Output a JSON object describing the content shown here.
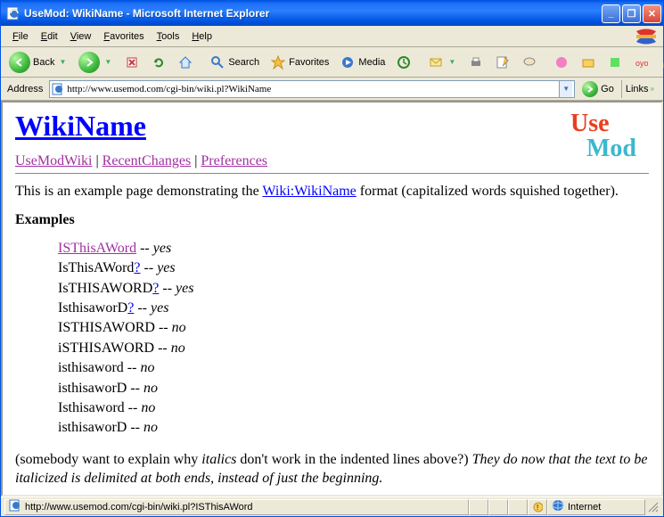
{
  "titlebar": {
    "title": "UseMod: WikiName - Microsoft Internet Explorer"
  },
  "menubar": {
    "items": [
      "File",
      "Edit",
      "View",
      "Favorites",
      "Tools",
      "Help"
    ]
  },
  "toolbar": {
    "back": "Back",
    "search": "Search",
    "favorites": "Favorites",
    "media": "Media"
  },
  "addressbar": {
    "label": "Address",
    "url": "http://www.usemod.com/cgi-bin/wiki.pl?WikiName",
    "go": "Go",
    "links": "Links"
  },
  "page": {
    "title": "WikiName",
    "nav": {
      "usemodwiki": "UseModWiki",
      "recentchanges": "RecentChanges",
      "preferences": "Preferences"
    },
    "intro_before": "This is an example page demonstrating the ",
    "intro_link": "Wiki:WikiName",
    "intro_after": " format (capitalized words squished together).",
    "examples_heading": "Examples",
    "examples": [
      {
        "text": "ISThisAWord",
        "link_class": "",
        "qmark": false,
        "dash": " -- ",
        "result": "yes"
      },
      {
        "text": "IsThisAWord",
        "link_class": "none",
        "qmark": true,
        "dash": " -- ",
        "result": "yes"
      },
      {
        "text": "IsTHISAWORD",
        "link_class": "none",
        "qmark": true,
        "dash": " -- ",
        "result": "yes"
      },
      {
        "text": "IsthisaworD",
        "link_class": "none",
        "qmark": true,
        "dash": " -- ",
        "result": "yes"
      },
      {
        "text": "ISTHISAWORD",
        "link_class": "none",
        "qmark": false,
        "dash": " -- ",
        "result": "no"
      },
      {
        "text": "iSTHISAWORD",
        "link_class": "none",
        "qmark": false,
        "dash": " -- ",
        "result": "no"
      },
      {
        "text": "isthisaword",
        "link_class": "none",
        "qmark": false,
        "dash": " -- ",
        "result": "no"
      },
      {
        "text": "isthisaworD",
        "link_class": "none",
        "qmark": false,
        "dash": " -- ",
        "result": "no"
      },
      {
        "text": "Isthisaword",
        "link_class": "none",
        "qmark": false,
        "dash": " -- ",
        "result": "no"
      },
      {
        "text": "isthisaworD",
        "link_class": "none",
        "qmark": false,
        "dash": " -- ",
        "result": "no"
      }
    ],
    "note_before": "(somebody want to explain why ",
    "note_italics": "italics",
    "note_mid": " don't work in the indented lines above?) ",
    "note_answer": "They do now that the text to be italicized is delimited at both ends, instead of just the beginning.",
    "logo": {
      "use": "Use",
      "mod": "Mod"
    }
  },
  "statusbar": {
    "text": "http://www.usemod.com/cgi-bin/wiki.pl?ISThisAWord",
    "zone": "Internet"
  }
}
